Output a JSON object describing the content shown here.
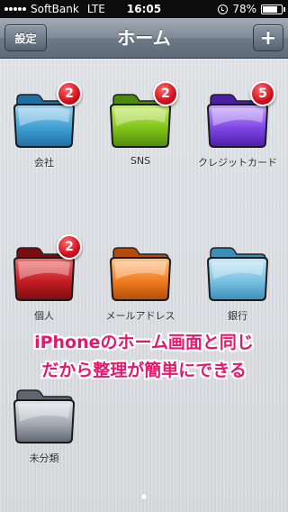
{
  "status_bar": {
    "carrier": "SoftBank",
    "network": "LTE",
    "time": "16:05",
    "battery": "78%",
    "battery_level": 0.78
  },
  "nav": {
    "title": "ホーム",
    "settings_label": "設定",
    "add_label": "+"
  },
  "folders": [
    {
      "label": "会社",
      "badge": "2",
      "color": "blue"
    },
    {
      "label": "SNS",
      "badge": "2",
      "color": "green"
    },
    {
      "label": "クレジットカード",
      "badge": "5",
      "color": "purple"
    },
    {
      "label": "個人",
      "badge": "2",
      "color": "red"
    },
    {
      "label": "メールアドレス",
      "badge": "",
      "color": "orange"
    },
    {
      "label": "銀行",
      "badge": "",
      "color": "lightblue"
    },
    {
      "label": "未分類",
      "badge": "",
      "color": "gray"
    }
  ],
  "caption": {
    "line1": "iPhoneのホーム画面と同じ",
    "line2": "だから整理が簡単にできる"
  },
  "colors": {
    "blue": [
      "#9fd6f2",
      "#3f9fd4",
      "#1f6fa3"
    ],
    "green": [
      "#c9f06a",
      "#82c51a",
      "#4c8a0c"
    ],
    "purple": [
      "#c9a8ff",
      "#8047e6",
      "#4c1ea8"
    ],
    "red": [
      "#f07070",
      "#c31d24",
      "#7d0c10"
    ],
    "orange": [
      "#ffc58a",
      "#f07c20",
      "#b24c08"
    ],
    "lightblue": [
      "#c6e8f6",
      "#79c1e2",
      "#3b8eb8"
    ],
    "gray": [
      "#e5e8ec",
      "#a3aab3",
      "#5f6670"
    ],
    "caption": "#e6186d"
  },
  "page_indicator": {
    "pages": 1,
    "current": 1
  }
}
